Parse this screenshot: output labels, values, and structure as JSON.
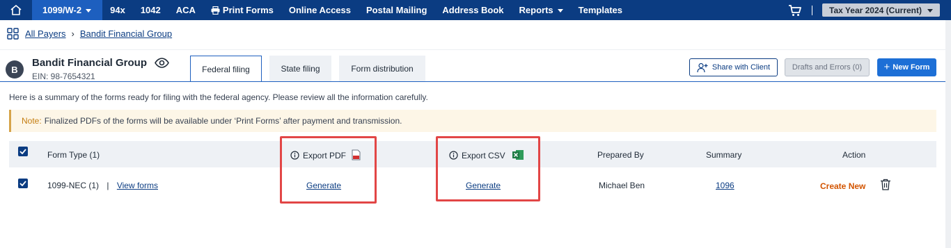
{
  "nav": {
    "active": "1099/W-2",
    "items": [
      "94x",
      "1042",
      "ACA",
      "Print Forms",
      "Online Access",
      "Postal Mailing",
      "Address Book",
      "Reports",
      "Templates"
    ],
    "tax_year": "Tax Year 2024 (Current)"
  },
  "breadcrumb": {
    "root": "All Payers",
    "current": "Bandit Financial Group"
  },
  "payer": {
    "initial": "B",
    "name": "Bandit Financial Group",
    "ein": "EIN: 98-7654321"
  },
  "tabs": [
    "Federal filing",
    "State filing",
    "Form distribution"
  ],
  "buttons": {
    "share": "Share with Client",
    "drafts": "Drafts and Errors (0)",
    "new_form": "New Form"
  },
  "summary_text": "Here is a summary of the forms ready for filing with the federal agency. Please review all the information carefully.",
  "note": {
    "label": "Note:",
    "text": "Finalized PDFs of the forms will be available under ‘Print Forms’ after payment and transmission."
  },
  "table": {
    "headers": {
      "form_type": "Form Type  (1)",
      "export_pdf": "Export PDF",
      "export_csv": "Export CSV",
      "prepared_by": "Prepared By",
      "summary": "Summary",
      "action": "Action"
    },
    "row": {
      "form": "1099-NEC (1)",
      "separator": "|",
      "view": "View forms",
      "pdf": "Generate",
      "csv": "Generate",
      "prepared_by": "Michael Ben",
      "summary": "1096",
      "action": "Create New"
    }
  },
  "colors": {
    "nav_bg": "#0b3c82",
    "active_tab": "#1d5fbf",
    "highlight": "#e24646",
    "create_new": "#d35400"
  }
}
